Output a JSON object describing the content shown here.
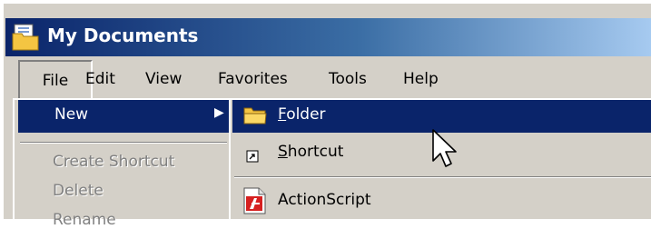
{
  "window": {
    "title": "My Documents",
    "title_icon": "my-documents-folder-icon"
  },
  "menubar": {
    "items": [
      "File",
      "Edit",
      "View",
      "Favorites",
      "Tools",
      "Help"
    ],
    "active": "File"
  },
  "file_menu": {
    "new_label": "New",
    "create_shortcut_label": "Create Shortcut",
    "delete_label": "Delete",
    "rename_label": "Rename"
  },
  "new_submenu": {
    "folder_label": "Folder",
    "shortcut_label": "Shortcut",
    "actionscript_label": "ActionScript"
  },
  "colors": {
    "highlight": "#0a246a",
    "menu_bg": "#d4d0c8",
    "disabled_text": "#808080"
  }
}
